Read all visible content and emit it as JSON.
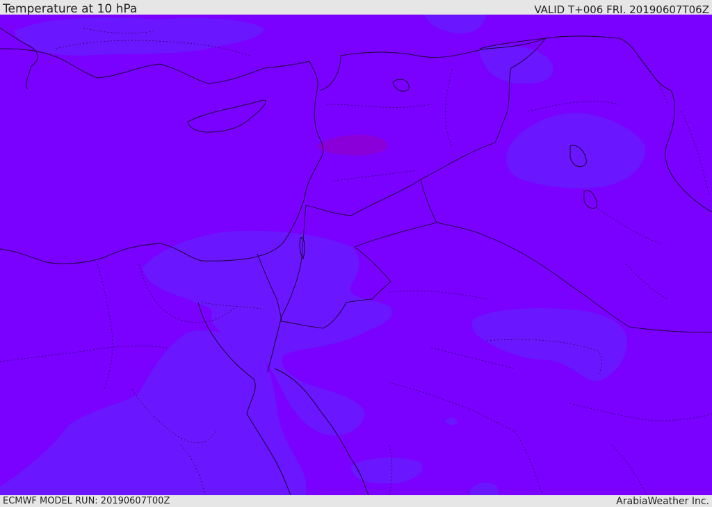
{
  "header": {
    "title": "Temperature at 10 hPa",
    "valid": "VALID T+006 FRI. 20190607T06Z"
  },
  "footer": {
    "model_run": "ECMWF MODEL RUN: 20190607T00Z",
    "credit": "ArabiaWeather Inc."
  },
  "map": {
    "field": "Temperature at 10 hPa",
    "colors": {
      "background": "#7a00ff",
      "cooler_region": "#6a17ff",
      "warmer_region": "#8a00d8",
      "coastline": "#1a0033",
      "border": "#2a0050"
    }
  }
}
